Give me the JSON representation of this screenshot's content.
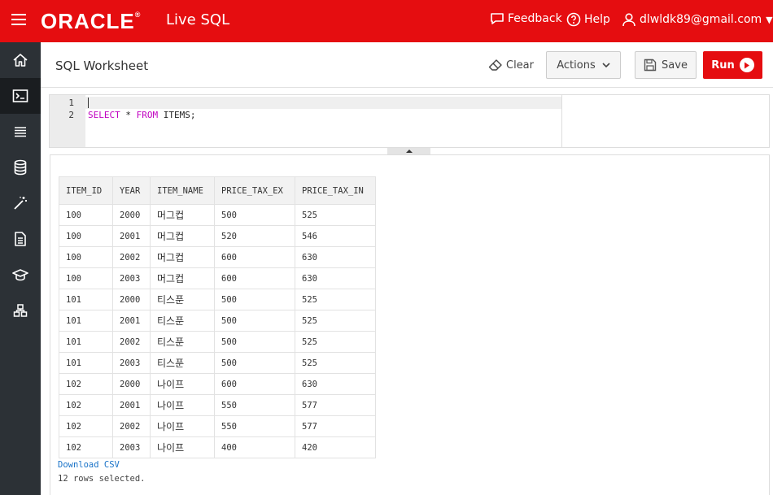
{
  "topbar": {
    "logo": "ORACLE",
    "logo_mark": "®",
    "product": "Live SQL",
    "feedback": "Feedback",
    "help": "Help",
    "user": "dlwldk89@gmail.com"
  },
  "sidebar": {
    "items": [
      {
        "icon": "home-icon"
      },
      {
        "icon": "sql-worksheet-icon",
        "active": true
      },
      {
        "icon": "list-icon"
      },
      {
        "icon": "database-icon"
      },
      {
        "icon": "magic-wand-icon"
      },
      {
        "icon": "document-icon"
      },
      {
        "icon": "graduation-cap-icon"
      },
      {
        "icon": "schema-icon"
      }
    ]
  },
  "header": {
    "title": "SQL Worksheet",
    "clear_label": "Clear",
    "actions_label": "Actions",
    "save_label": "Save",
    "run_label": "Run"
  },
  "editor": {
    "line_numbers": [
      "1",
      "2"
    ],
    "line1": "",
    "line2_kw1": "SELECT",
    "line2_mid": " * ",
    "line2_kw2": "FROM",
    "line2_rest": " ITEMS;"
  },
  "results": {
    "columns": [
      "ITEM_ID",
      "YEAR",
      "ITEM_NAME",
      "PRICE_TAX_EX",
      "PRICE_TAX_IN"
    ],
    "rows": [
      [
        "100",
        "2000",
        "머그컵",
        "500",
        "525"
      ],
      [
        "100",
        "2001",
        "머그컵",
        "520",
        "546"
      ],
      [
        "100",
        "2002",
        "머그컵",
        "600",
        "630"
      ],
      [
        "100",
        "2003",
        "머그컵",
        "600",
        "630"
      ],
      [
        "101",
        "2000",
        "티스푼",
        "500",
        "525"
      ],
      [
        "101",
        "2001",
        "티스푼",
        "500",
        "525"
      ],
      [
        "101",
        "2002",
        "티스푼",
        "500",
        "525"
      ],
      [
        "101",
        "2003",
        "티스푼",
        "500",
        "525"
      ],
      [
        "102",
        "2000",
        "나이프",
        "600",
        "630"
      ],
      [
        "102",
        "2001",
        "나이프",
        "550",
        "577"
      ],
      [
        "102",
        "2002",
        "나이프",
        "550",
        "577"
      ],
      [
        "102",
        "2003",
        "나이프",
        "400",
        "420"
      ]
    ],
    "download_label": "Download CSV",
    "rows_message": "12 rows selected."
  },
  "colors": {
    "brand_red": "#e50d10",
    "sidebar_bg": "#2c3136",
    "link_blue": "#1a73c8",
    "keyword_magenta": "#c000c0"
  }
}
